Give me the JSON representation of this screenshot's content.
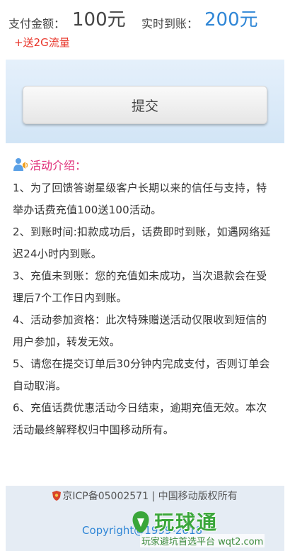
{
  "payment": {
    "amount_label": "支付金额：",
    "amount_value": "100元",
    "realtime_label": "实时到账：",
    "realtime_value": "200元",
    "bonus": "+送2G流量"
  },
  "submit": {
    "label": "提交"
  },
  "intro": {
    "icon": "speaker-user-icon",
    "title": "活动介绍：",
    "rules": [
      "1、为了回馈答谢星级客户长期以来的信任与支持，特举办话费充值100送100活动。",
      "2、到账时间:扣款成功后，话费即时到账，如遇网络延迟24小时内到账。",
      "3、充值未到账：您的充值如未成功，当次退款会在受理后7个工作日内到账。",
      "4、活动参加资格：此次特殊赠送活动仅限收到短信的用户参加，转发无效。",
      "5、请您在提交订单后30分钟内完成支付，否则订单会自动取消。",
      "6、充值话费优惠活动今日结束，逾期充值无效。本次活动最终解释权归中国移动所有。"
    ]
  },
  "footer": {
    "icp": "京ICP备05002571 | 中国移动版权所有",
    "copyright": "Copyright@1999-2018"
  },
  "watermark": {
    "brand": "玩球通",
    "tagline": "玩家避坑首选平台 wqt2.com"
  },
  "colors": {
    "accent_blue": "#2f86d6",
    "bonus_red": "#e8352a",
    "title_pink": "#e0307a",
    "band_blue": "#d2e5f6"
  }
}
